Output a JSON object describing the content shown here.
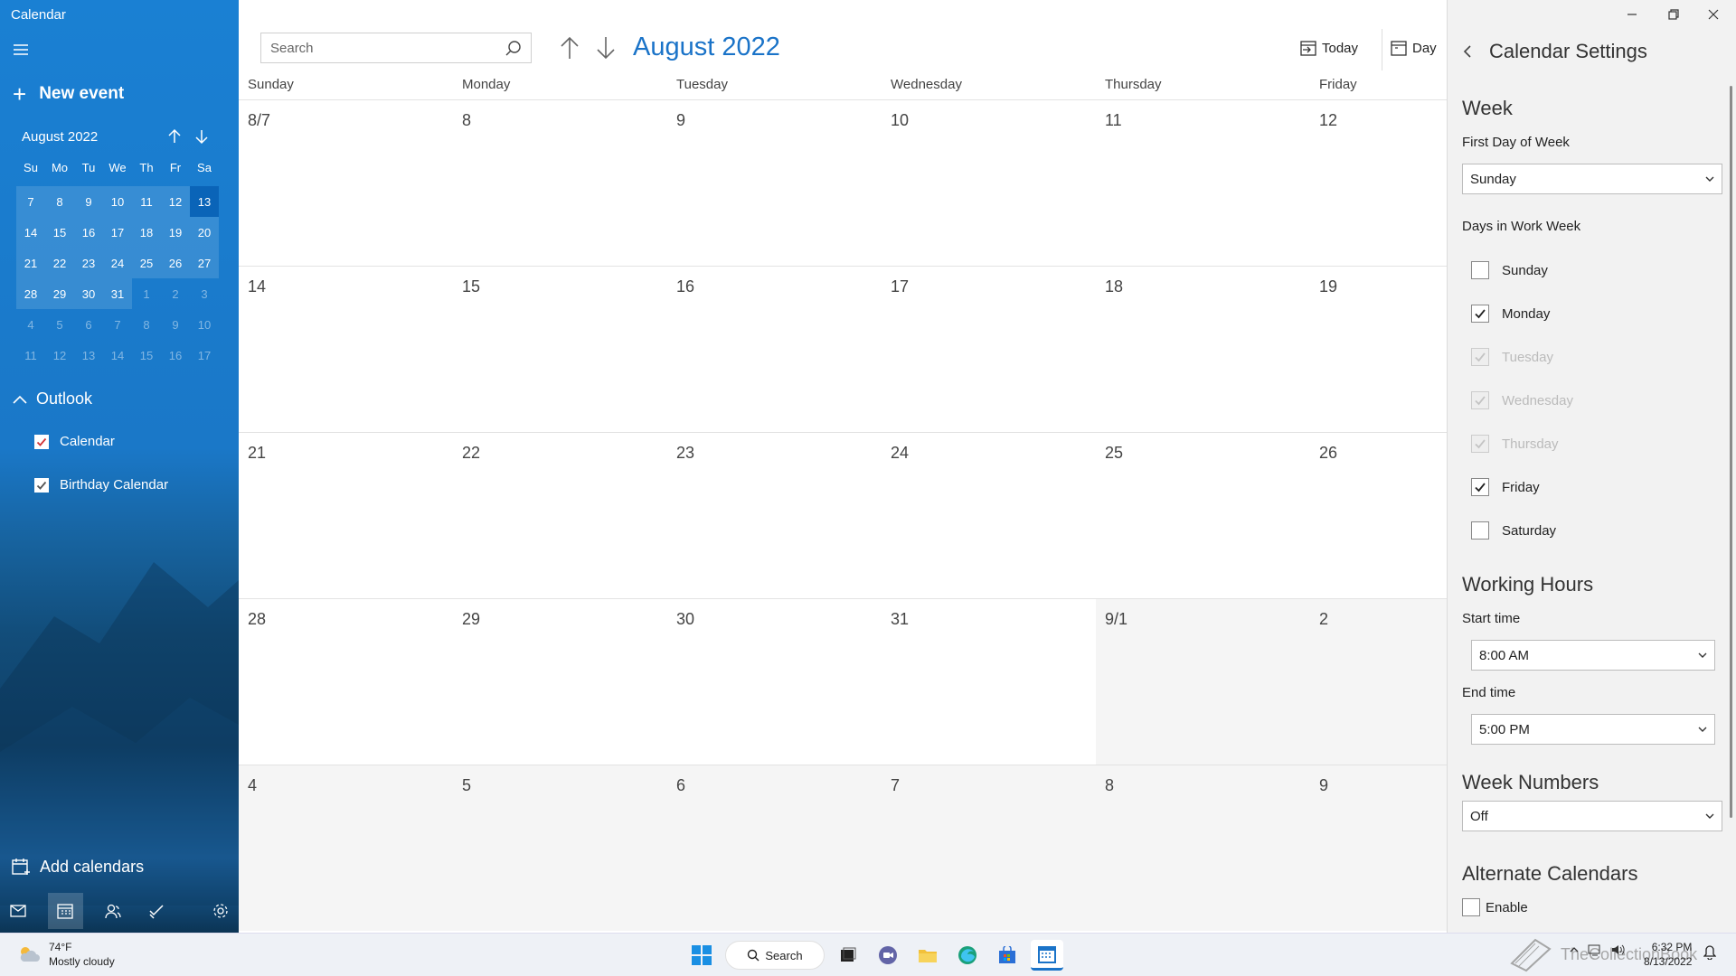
{
  "app": {
    "title": "Calendar"
  },
  "sidebar": {
    "new_event": "New event",
    "mini_calendar": {
      "title": "August 2022",
      "weekday_headers": [
        "Su",
        "Mo",
        "Tu",
        "We",
        "Th",
        "Fr",
        "Sa"
      ],
      "weeks": [
        [
          "7",
          "8",
          "9",
          "10",
          "11",
          "12",
          "13"
        ],
        [
          "14",
          "15",
          "16",
          "17",
          "18",
          "19",
          "20"
        ],
        [
          "21",
          "22",
          "23",
          "24",
          "25",
          "26",
          "27"
        ],
        [
          "28",
          "29",
          "30",
          "31",
          "1",
          "2",
          "3"
        ],
        [
          "4",
          "5",
          "6",
          "7",
          "8",
          "9",
          "10"
        ],
        [
          "11",
          "12",
          "13",
          "14",
          "15",
          "16",
          "17"
        ]
      ],
      "selected": "13"
    },
    "account": "Outlook",
    "calendars": [
      {
        "label": "Calendar",
        "checked": true,
        "color": "#d13438"
      },
      {
        "label": "Birthday Calendar",
        "checked": true,
        "color": "#555555"
      }
    ],
    "add_calendars": "Add calendars",
    "nav_icons": [
      "mail-icon",
      "calendar-icon",
      "people-icon",
      "todo-icon",
      "settings-icon"
    ]
  },
  "toolbar": {
    "search_placeholder": "Search",
    "month_title": "August 2022",
    "today_label": "Today",
    "day_label": "Day"
  },
  "month_grid": {
    "weekdays": [
      "Sunday",
      "Monday",
      "Tuesday",
      "Wednesday",
      "Thursday",
      "Friday"
    ],
    "weeks": [
      [
        "8/7",
        "8",
        "9",
        "10",
        "11",
        "12"
      ],
      [
        "14",
        "15",
        "16",
        "17",
        "18",
        "19"
      ],
      [
        "21",
        "22",
        "23",
        "24",
        "25",
        "26"
      ],
      [
        "28",
        "29",
        "30",
        "31",
        "9/1",
        "2"
      ],
      [
        "4",
        "5",
        "6",
        "7",
        "8",
        "9"
      ]
    ]
  },
  "settings": {
    "title": "Calendar Settings",
    "week_heading": "Week",
    "first_day_label": "First Day of Week",
    "first_day_value": "Sunday",
    "work_week_label": "Days in Work Week",
    "work_days": [
      {
        "label": "Sunday",
        "checked": false,
        "disabled": false
      },
      {
        "label": "Monday",
        "checked": true,
        "disabled": false
      },
      {
        "label": "Tuesday",
        "checked": true,
        "disabled": true
      },
      {
        "label": "Wednesday",
        "checked": true,
        "disabled": true
      },
      {
        "label": "Thursday",
        "checked": true,
        "disabled": true
      },
      {
        "label": "Friday",
        "checked": true,
        "disabled": false
      },
      {
        "label": "Saturday",
        "checked": false,
        "disabled": false
      }
    ],
    "working_hours_heading": "Working Hours",
    "start_label": "Start time",
    "start_value": "8:00 AM",
    "end_label": "End time",
    "end_value": "5:00 PM",
    "week_numbers_heading": "Week Numbers",
    "week_numbers_value": "Off",
    "alt_cal_heading": "Alternate Calendars",
    "enable_label": "Enable"
  },
  "taskbar": {
    "weather_temp": "74°F",
    "weather_desc": "Mostly cloudy",
    "search_label": "Search",
    "time": "6:32 PM",
    "date": "8/13/2022",
    "watermark": "TheCollectionBook"
  },
  "colors": {
    "accent": "#1a73c8",
    "sidebar": "#1a78c8",
    "selected_day": "#0a64b8"
  }
}
